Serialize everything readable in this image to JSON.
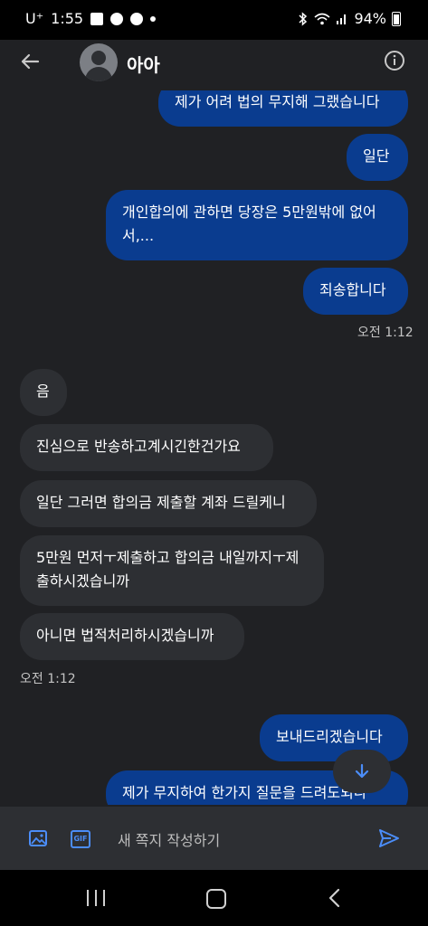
{
  "status_bar": {
    "carrier": "U⁺",
    "time": "1:55",
    "battery": "94%"
  },
  "header": {
    "contact_name": "아아"
  },
  "messages": [
    {
      "dir": "out",
      "text": "제가 어려 법의 무지해 그랬습니다"
    },
    {
      "dir": "out",
      "text": "일단"
    },
    {
      "dir": "out",
      "text": "개인합의에 관하면 당장은 5만원밖에 없어서,..."
    },
    {
      "dir": "out",
      "text": "죄송합니다"
    },
    {
      "dir": "time_right",
      "text": "오전 1:12"
    },
    {
      "dir": "in",
      "text": "음"
    },
    {
      "dir": "in",
      "text": "진심으로 반송하고계시긴한건가요"
    },
    {
      "dir": "in",
      "text": "일단 그러면 합의금 제출할 계좌 드릴케니"
    },
    {
      "dir": "in",
      "text": "5만원 먼저ㅜ제출하고 합의금 내일까지ㅜ제출하시겠습니까"
    },
    {
      "dir": "in",
      "text": "아니면 법적처리하시겠습니까"
    },
    {
      "dir": "time_left",
      "text": "오전 1:12"
    },
    {
      "dir": "out",
      "text": "보내드리겠습니다"
    },
    {
      "dir": "out",
      "text": "제가 무지하여 한가지 질문을 드려도되나"
    }
  ],
  "composer": {
    "placeholder": "새 쪽지 작성하기",
    "gif_label": "GIF"
  }
}
